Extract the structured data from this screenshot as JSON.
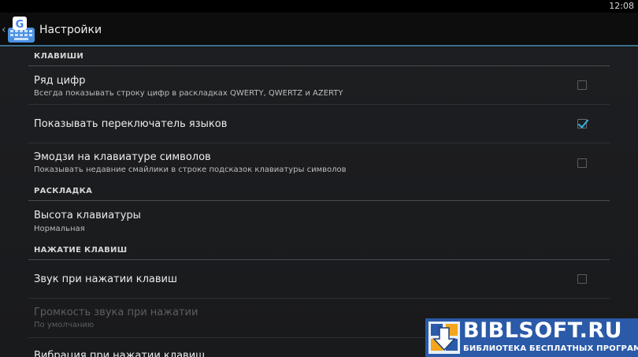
{
  "status_bar": {
    "time": "12:08"
  },
  "action_bar": {
    "back_icon": "chevron-left-icon",
    "app_icon": "gboard-app-icon",
    "app_icon_letter": "G",
    "title": "Настройки",
    "accent_color": "#3b6f8a"
  },
  "sections": [
    {
      "header": "КЛАВИШИ"
    },
    {
      "header": "РАСКЛАДКА"
    },
    {
      "header": "НАЖАТИЕ КЛАВИШ"
    }
  ],
  "prefs": {
    "number_row": {
      "title": "Ряд цифр",
      "summary": "Всегда показывать строку цифр в раскладках QWERTY, QWERTZ и AZERTY",
      "checked": false
    },
    "language_switch": {
      "title": "Показывать переключатель языков",
      "checked": true
    },
    "emoji_symbols": {
      "title": "Эмодзи на клавиатуре символов",
      "summary": "Показывать недавние смайлики в строке подсказок клавиатуры символов",
      "checked": false
    },
    "keyboard_height": {
      "title": "Высота клавиатуры",
      "summary": "Нормальная"
    },
    "key_sound": {
      "title": "Звук при нажатии клавиш",
      "checked": false
    },
    "sound_volume": {
      "title": "Громкость звука при нажатии",
      "summary": "По умолчанию",
      "disabled": true
    },
    "vibration": {
      "title": "Вибрация при нажатии клавиш"
    }
  },
  "checkbox_accent": "#33b5e5",
  "watermark": {
    "title": "BIBLSOFT.RU",
    "subtitle": "БИБЛИОТЕКА БЕСПЛАТНЫХ ПРОГРАММ",
    "icon": "download-arrow-icon",
    "color": "#2a5aa8"
  }
}
